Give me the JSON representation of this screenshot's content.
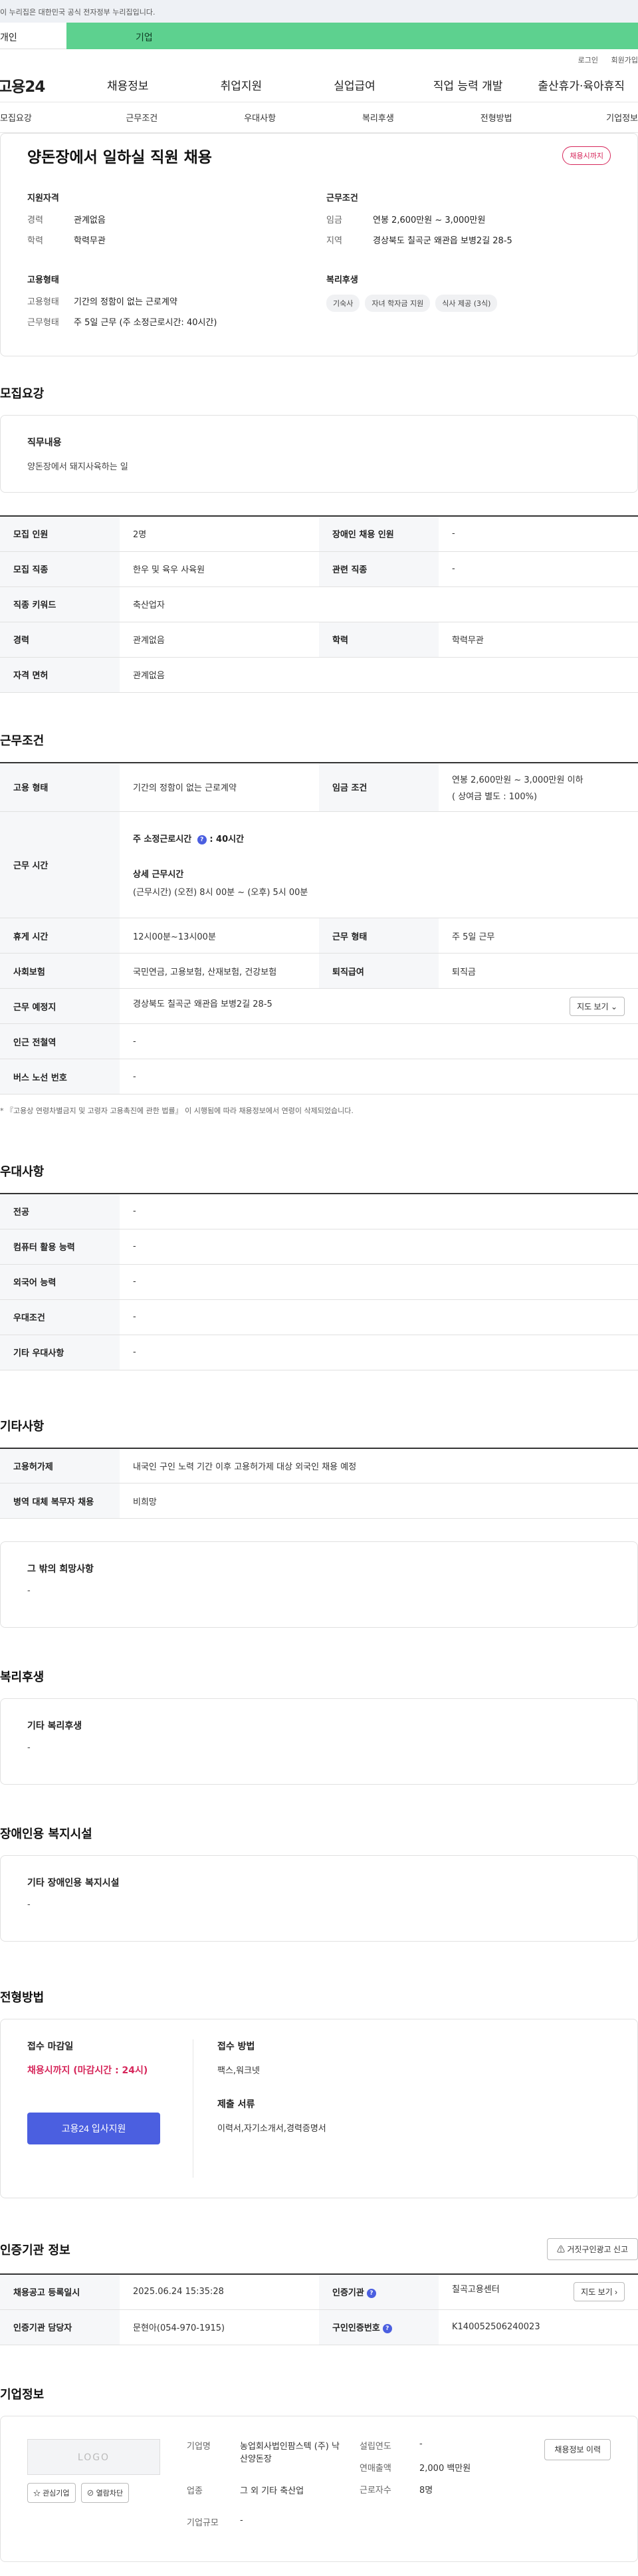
{
  "banner": {
    "text": "이 누리집은 대한민국 공식 전자정부 누리집입니다."
  },
  "top_tabs": {
    "personal": "개인",
    "company": "기업"
  },
  "util": {
    "login": "로그인",
    "signup": "회원가입"
  },
  "gnb": {
    "logo": "고용24",
    "items": [
      "채용정보",
      "취업지원",
      "실업급여",
      "직업 능력 개발",
      "출산휴가·육아휴직"
    ]
  },
  "subnav": [
    "모집요강",
    "근무조건",
    "우대사항",
    "복리후생",
    "전형방법",
    "기업정보"
  ],
  "summary": {
    "title": "양돈장에서 일하실 직원 채용",
    "status_badge": "채용시까지",
    "qualification": {
      "heading": "지원자격",
      "rows": [
        {
          "k": "경력",
          "v": "관계없음"
        },
        {
          "k": "학력",
          "v": "학력무관"
        }
      ]
    },
    "conditions": {
      "heading": "근무조건",
      "rows": [
        {
          "k": "임금",
          "v": "연봉 2,600만원 ~ 3,000만원"
        },
        {
          "k": "지역",
          "v": "경상북도 칠곡군 왜관읍 보병2길 28-5"
        }
      ]
    },
    "employment": {
      "heading": "고용형태",
      "rows": [
        {
          "k": "고용형태",
          "v": "기간의 정함이 없는 근로계약"
        },
        {
          "k": "근무형태",
          "v": "주 5일 근무 (주 소정근로시간: 40시간)"
        }
      ]
    },
    "welfare": {
      "heading": "복리후생",
      "chips": [
        "기숙사",
        "자녀 학자금 지원",
        "식사 제공 (3식)"
      ]
    }
  },
  "recruit": {
    "title": "모집요강",
    "duty_heading": "직무내용",
    "duty_text": "양돈장에서 돼지사육하는 일",
    "rows": [
      {
        "k1": "모집 인원",
        "v1": "2명",
        "k2": "장애인 채용 인원",
        "v2": "-"
      },
      {
        "k1": "모집 직종",
        "v1": "한우 및 육우 사육원",
        "k2": "관련 직종",
        "v2": "-"
      },
      {
        "k1": "직종 키워드",
        "v1": "축산업자"
      },
      {
        "k1": "경력",
        "v1": "관계없음",
        "k2": "학력",
        "v2": "학력무관"
      },
      {
        "k1": "자격 면허",
        "v1": "관계없음"
      }
    ]
  },
  "work": {
    "title": "근무조건",
    "employment_type_k": "고용 형태",
    "employment_type_v": "기간의 정함이 없는 근로계약",
    "wage_k": "임금 조건",
    "wage_v1": "연봉 2,600만원 ~ 3,000만원 이하",
    "wage_v2": "( 상여금 별도 : 100%)",
    "hours_k": "근무 시간",
    "hours_label": "주 소정근로시간",
    "hours_value": ": 40시간",
    "detail_label": "상세 근무시간",
    "detail_value": "(근무시간) (오전) 8시 00분 ~ (오후) 5시 00분",
    "break_k": "휴게 시간",
    "break_v": "12시00분~13시00분",
    "form_k": "근무 형태",
    "form_v": "주 5일 근무",
    "insurance_k": "사회보험",
    "insurance_v": "국민연금, 고용보험, 산재보험, 건강보험",
    "severance_k": "퇴직급여",
    "severance_v": "퇴직금",
    "place_k": "근무 예정지",
    "place_v": "경상북도 칠곡군 왜관읍 보병2길 28-5",
    "map_btn": "지도 보기",
    "subway_k": "인근 전철역",
    "subway_v": "-",
    "bus_k": "버스 노선 번호",
    "bus_v": "-",
    "note": "* 『고용상 연령차별금지 및 고령자 고용촉진에 관한 법률』 이 시행됨에 따라 채용정보에서 연령이 삭제되었습니다."
  },
  "prefer": {
    "title": "우대사항",
    "rows": [
      {
        "k": "전공",
        "v": "-"
      },
      {
        "k": "컴퓨터 활용 능력",
        "v": "-"
      },
      {
        "k": "외국어 능력",
        "v": "-"
      },
      {
        "k": "우대조건",
        "v": "-"
      },
      {
        "k": "기타 우대사항",
        "v": "-"
      }
    ]
  },
  "etc": {
    "title": "기타사항",
    "rows": [
      {
        "k": "고용허가제",
        "v": "내국인 구인 노력 기간 이후 고용허가제 대상 외국인 채용 예정"
      },
      {
        "k": "병역 대체 복무자 채용",
        "v": "비희망"
      }
    ],
    "other_heading": "그 밖의 희망사항",
    "other_text": "-"
  },
  "benefit": {
    "title": "복리후생",
    "heading": "기타 복리후생",
    "text": "-"
  },
  "disability": {
    "title": "장애인용 복지시설",
    "heading": "기타 장애인용 복지시설",
    "text": "-"
  },
  "selection": {
    "title": "전형방법",
    "deadline_heading": "접수 마감일",
    "deadline": "채용시까지 (마감시간 : 24시)",
    "apply_btn": "고용24 입사지원",
    "method_heading": "접수 방법",
    "method": "팩스,워크넷",
    "docs_heading": "제출 서류",
    "docs": "이력서,자기소개서,경력증명서"
  },
  "cert": {
    "title": "인증기관 정보",
    "report_btn": "거짓구인광고 신고",
    "reg_k": "채용공고 등록일시",
    "reg_v": "2025.06.24 15:35:28",
    "org_k": "인증기관",
    "org_v": "칠곡고용센터",
    "map_btn": "지도 보기",
    "manager_k": "인증기관 담당자",
    "manager_v": "문현아(054-970-1915)",
    "num_k": "구인인증번호",
    "num_v": "K140052506240023"
  },
  "company": {
    "title": "기업정보",
    "logo": "LOGO",
    "fav_btn": "관심기업",
    "block_btn": "열람차단",
    "name_k": "기업명",
    "name_v": "농업회사법인팜스텍 (주) 낙산양돈장",
    "industry_k": "업종",
    "industry_v": "그 외 기타 축산업",
    "size_k": "기업규모",
    "size_v": "-",
    "year_k": "설립연도",
    "year_v": "-",
    "sales_k": "연매출액",
    "sales_v": "2,000 백만원",
    "staff_k": "근로자수",
    "staff_v": "8명",
    "history_btn": "채용정보 이력"
  }
}
